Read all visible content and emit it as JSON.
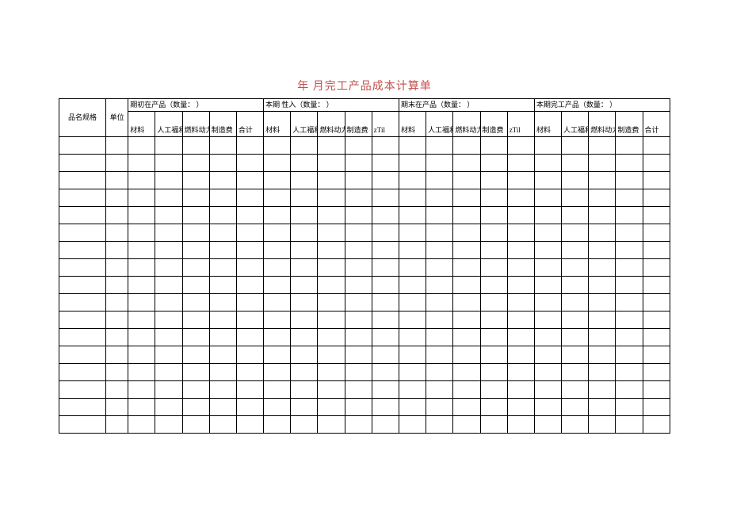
{
  "title": "年    月完工产品成本计算单",
  "header": {
    "row1": {
      "spec": "品名规格",
      "unit": "单位",
      "group1": "期初在产品（数量：                    ）",
      "group2": "本期    性入（数量：                ）",
      "group3": "期末在产品（数量：                 ）",
      "group4": "本期完工产品（数量：                 ）"
    },
    "row2": {
      "g1": {
        "c1": "材料",
        "c2": "人工福利",
        "c3": "燃料动力",
        "c4": "制造费",
        "c5": "合计"
      },
      "g2": {
        "c1": "材料",
        "c2": "人工福利",
        "c3": "燃料动力",
        "c4": "制造费",
        "c5": "zTil"
      },
      "g3": {
        "c1": "材料",
        "c2": "人工福利",
        "c3": "燃料动力",
        "c4": "制造费",
        "c5": "zTil"
      },
      "g4": {
        "c1": "材料",
        "c2": "人工福利",
        "c3": "燃料动力",
        "c4": "制造费",
        "c5": "合计"
      }
    }
  },
  "rows": [
    {},
    {},
    {},
    {},
    {},
    {},
    {},
    {},
    {},
    {},
    {},
    {},
    {},
    {},
    {},
    {},
    {}
  ]
}
